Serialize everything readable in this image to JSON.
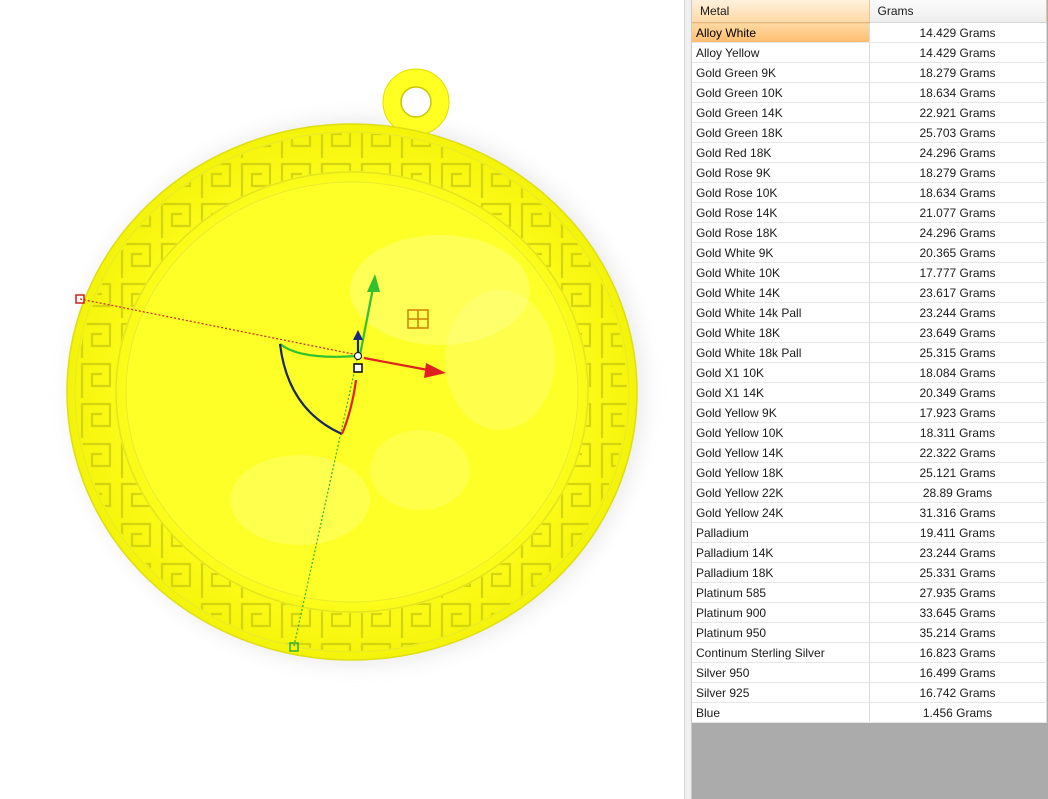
{
  "table": {
    "columns": [
      "Metal",
      "Grams"
    ],
    "rows": [
      {
        "metal": "Alloy White",
        "grams": "14.429 Grams"
      },
      {
        "metal": "Alloy Yellow",
        "grams": "14.429 Grams"
      },
      {
        "metal": "Gold Green 9K",
        "grams": "18.279 Grams"
      },
      {
        "metal": "Gold Green 10K",
        "grams": "18.634 Grams"
      },
      {
        "metal": "Gold Green 14K",
        "grams": "22.921 Grams"
      },
      {
        "metal": "Gold Green 18K",
        "grams": "25.703 Grams"
      },
      {
        "metal": "Gold Red 18K",
        "grams": "24.296 Grams"
      },
      {
        "metal": "Gold Rose 9K",
        "grams": "18.279 Grams"
      },
      {
        "metal": "Gold Rose 10K",
        "grams": "18.634 Grams"
      },
      {
        "metal": "Gold Rose 14K",
        "grams": "21.077 Grams"
      },
      {
        "metal": "Gold Rose 18K",
        "grams": "24.296 Grams"
      },
      {
        "metal": "Gold White 9K",
        "grams": "20.365 Grams"
      },
      {
        "metal": "Gold White 10K",
        "grams": "17.777 Grams"
      },
      {
        "metal": "Gold White 14K",
        "grams": "23.617 Grams"
      },
      {
        "metal": "Gold White 14k Pall",
        "grams": "23.244 Grams"
      },
      {
        "metal": "Gold White 18K",
        "grams": "23.649 Grams"
      },
      {
        "metal": "Gold White 18k Pall",
        "grams": "25.315 Grams"
      },
      {
        "metal": "Gold X1 10K",
        "grams": "18.084 Grams"
      },
      {
        "metal": "Gold X1 14K",
        "grams": "20.349 Grams"
      },
      {
        "metal": "Gold Yellow 9K",
        "grams": "17.923 Grams"
      },
      {
        "metal": "Gold Yellow 10K",
        "grams": "18.311 Grams"
      },
      {
        "metal": "Gold Yellow 14K",
        "grams": "22.322 Grams"
      },
      {
        "metal": "Gold Yellow 18K",
        "grams": "25.121 Grams"
      },
      {
        "metal": "Gold Yellow 22K",
        "grams": "28.89 Grams"
      },
      {
        "metal": "Gold Yellow 24K",
        "grams": "31.316 Grams"
      },
      {
        "metal": "Palladium",
        "grams": "19.411 Grams"
      },
      {
        "metal": "Palladium 14K",
        "grams": "23.244 Grams"
      },
      {
        "metal": "Palladium 18K",
        "grams": "25.331 Grams"
      },
      {
        "metal": "Platinum 585",
        "grams": "27.935 Grams"
      },
      {
        "metal": "Platinum 900",
        "grams": "33.645 Grams"
      },
      {
        "metal": "Platinum 950",
        "grams": "35.214 Grams"
      },
      {
        "metal": "Continum Sterling Silver",
        "grams": "16.823 Grams"
      },
      {
        "metal": "Silver 950",
        "grams": "16.499 Grams"
      },
      {
        "metal": "Silver 925",
        "grams": "16.742 Grams"
      },
      {
        "metal": "Blue",
        "grams": "1.456 Grams"
      }
    ],
    "selected_index": 0
  },
  "viewport": {
    "object": "pendant",
    "material_color": "#ffff22",
    "icons": [
      "gumball-x-arrow-icon",
      "gumball-y-arrow-icon",
      "gumball-z-arrow-icon",
      "gumball-rotation-arc-icon",
      "gumball-scale-handle-icon",
      "gumball-plane-handle-icon"
    ]
  },
  "colors": {
    "selection": "#ffc47e",
    "panel_background": "#ababab",
    "x_axis": "#e02020",
    "y_axis": "#30c030",
    "z_axis": "#1a2a80"
  }
}
